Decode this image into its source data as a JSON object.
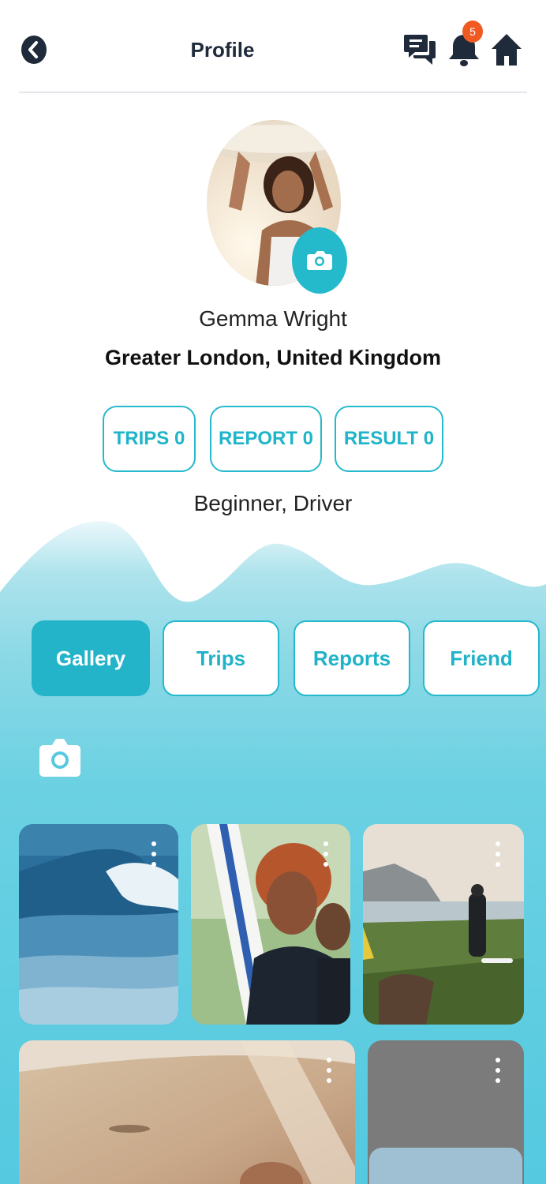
{
  "header": {
    "title": "Profile",
    "notification_count": "5"
  },
  "icons": {
    "back": "back-chevron-icon",
    "chat": "chat-bubbles-icon",
    "notifications": "bell-icon",
    "home": "home-icon",
    "camera": "camera-icon",
    "more": "more-vertical-icon"
  },
  "profile": {
    "name": "Gemma Wright",
    "location": "Greater London, United Kingdom",
    "level": "Beginner, Driver"
  },
  "stats": [
    {
      "label": "TRIPS 0"
    },
    {
      "label": "REPORT 0"
    },
    {
      "label": "RESULT 0"
    }
  ],
  "tabs": [
    {
      "label": "Gallery",
      "active": true
    },
    {
      "label": "Trips",
      "active": false
    },
    {
      "label": "Reports",
      "active": false
    },
    {
      "label": "Friend",
      "active": false
    }
  ],
  "colors": {
    "accent": "#25b9cc",
    "badge": "#f05a22",
    "dark_icon": "#1f2a3b"
  }
}
